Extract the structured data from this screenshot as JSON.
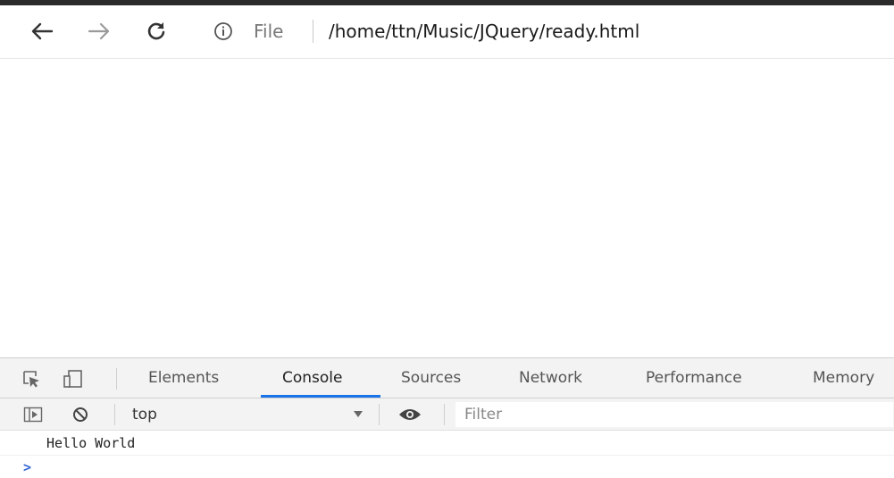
{
  "browser": {
    "file_label": "File",
    "url": "/home/ttn/Music/JQuery/ready.html",
    "icons": {
      "back": "arrow-left-icon",
      "forward": "arrow-right-icon",
      "reload": "reload-icon",
      "info": "info-icon"
    }
  },
  "devtools": {
    "tabs": [
      {
        "label": "Elements"
      },
      {
        "label": "Console"
      },
      {
        "label": "Sources"
      },
      {
        "label": "Network"
      },
      {
        "label": "Performance"
      },
      {
        "label": "Memory"
      }
    ],
    "active_tab": "Console",
    "accent": "#1a73e8",
    "console": {
      "context": "top",
      "filter_placeholder": "Filter",
      "logs": [
        "Hello World"
      ],
      "prompt": ">"
    }
  }
}
